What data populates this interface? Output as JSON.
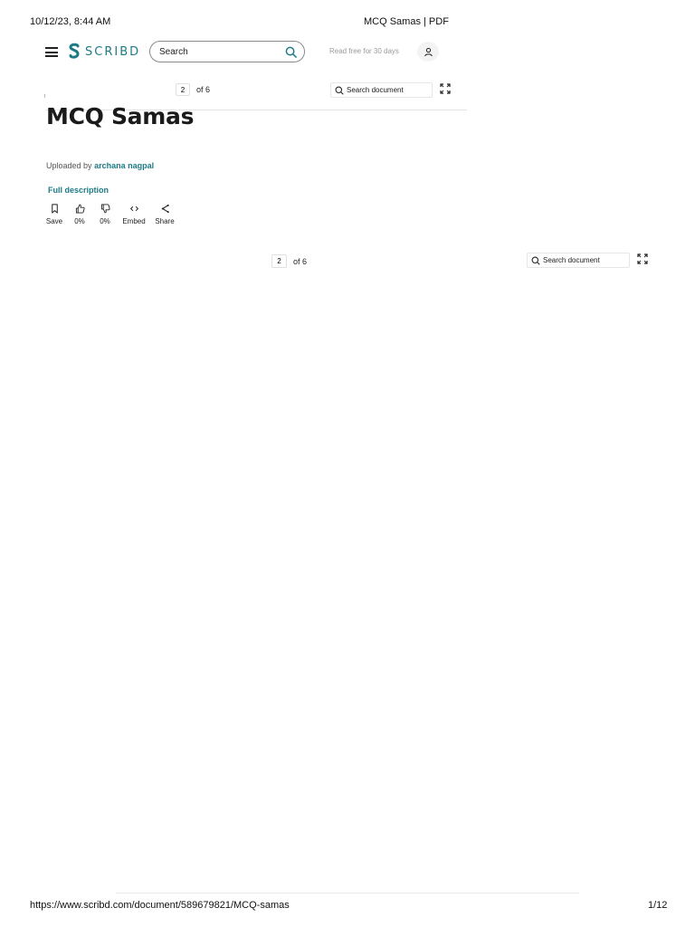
{
  "print_header": {
    "datetime": "10/12/23, 8:44 AM",
    "title": "MCQ Samas | PDF"
  },
  "print_footer": {
    "url": "https://www.scribd.com/document/589679821/MCQ-samas",
    "page": "1/12"
  },
  "nav": {
    "logo_text": "SCRIBD",
    "search_placeholder": "Search",
    "promo": "Read free for 30 days"
  },
  "toolbar_top": {
    "page_value": "2",
    "page_total": "of 6",
    "search_placeholder": "Search document"
  },
  "document": {
    "title": "MCQ Samas",
    "uploaded_by_label": "Uploaded by",
    "uploader": "archana nagpal",
    "full_description": "Full description"
  },
  "actions": [
    {
      "label": "Save",
      "icon": "bookmark-icon"
    },
    {
      "label": "0%",
      "icon": "thumbs-up-icon"
    },
    {
      "label": "0%",
      "icon": "thumbs-down-icon"
    },
    {
      "label": "Embed",
      "icon": "embed-icon"
    },
    {
      "label": "Share",
      "icon": "share-icon"
    }
  ],
  "toolbar_bottom": {
    "page_value": "2",
    "page_total": "of 6",
    "search_placeholder": "Search document"
  },
  "colors": {
    "brand": "#1e7b85"
  }
}
